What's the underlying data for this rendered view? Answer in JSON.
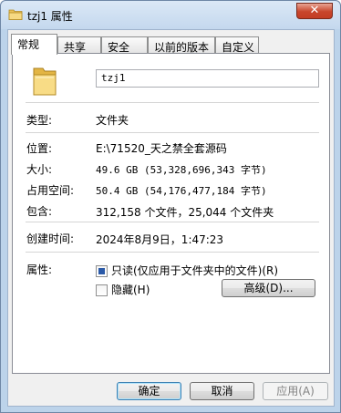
{
  "window": {
    "title": "tzj1 属性",
    "close_label": "✕"
  },
  "tabs": [
    {
      "label": "常规"
    },
    {
      "label": "共享"
    },
    {
      "label": "安全"
    },
    {
      "label": "以前的版本"
    },
    {
      "label": "自定义"
    }
  ],
  "general": {
    "folder_name": "tzj1",
    "type_label": "类型:",
    "type_value": "文件夹",
    "location_label": "位置:",
    "location_value": "E:\\71520_天之禁全套源码",
    "size_label": "大小:",
    "size_value": "49.6 GB (53,328,696,343 字节)",
    "disk_size_label": "占用空间:",
    "disk_size_value": "50.4 GB (54,176,477,184 字节)",
    "contains_label": "包含:",
    "contains_value": "312,158 个文件，25,044 个文件夹",
    "created_label": "创建时间:",
    "created_value": "2024年8月9日，1:47:23",
    "attributes_label": "属性:",
    "readonly_label": "只读(仅应用于文件夹中的文件)(R)",
    "readonly_state": "indeterminate",
    "hidden_label": "隐藏(H)",
    "hidden_checked": false,
    "advanced_label": "高级(D)..."
  },
  "footer": {
    "ok_label": "确定",
    "cancel_label": "取消",
    "apply_label": "应用(A)"
  }
}
